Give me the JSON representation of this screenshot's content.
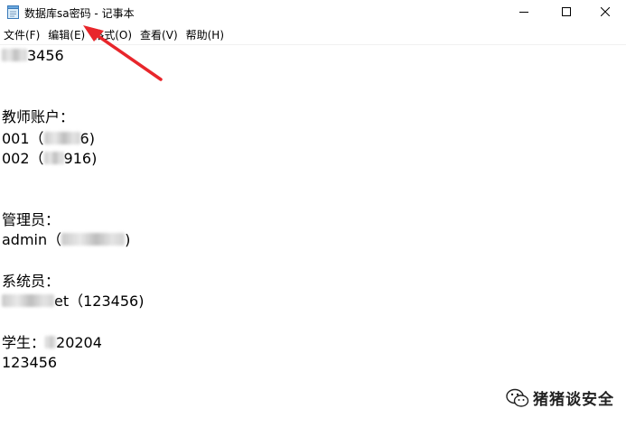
{
  "window": {
    "title": "数据库sa密码 - 记事本",
    "minimize_symbol": "—",
    "maximize_symbol": "☐",
    "close_symbol": "✕"
  },
  "menu": [
    {
      "label": "文件(F)"
    },
    {
      "label": "编辑(E)"
    },
    {
      "label": "格式(O)"
    },
    {
      "label": "查看(V)"
    },
    {
      "label": "帮助(H)"
    }
  ],
  "document": {
    "lines": [
      {
        "before": "",
        "after": "3456"
      },
      {
        "text": "教师账户："
      },
      {
        "before": "001（",
        "after": "6)"
      },
      {
        "before": "002（",
        "after": "916)"
      },
      {
        "text": "管理员："
      },
      {
        "before": "admin（",
        "after": ")"
      },
      {
        "text": "系统员："
      },
      {
        "before": "",
        "after": "et（123456)"
      },
      {
        "before": "学生：",
        "after": "20204"
      },
      {
        "text": "123456"
      }
    ]
  },
  "watermark": {
    "text": "猪猪谈安全",
    "icon": "wechat-icon"
  },
  "annotation": {
    "icon": "red-arrow",
    "color": "#e8262b"
  },
  "colors": {
    "background": "#ffffff",
    "text": "#000000",
    "arrow": "#e8262b"
  }
}
